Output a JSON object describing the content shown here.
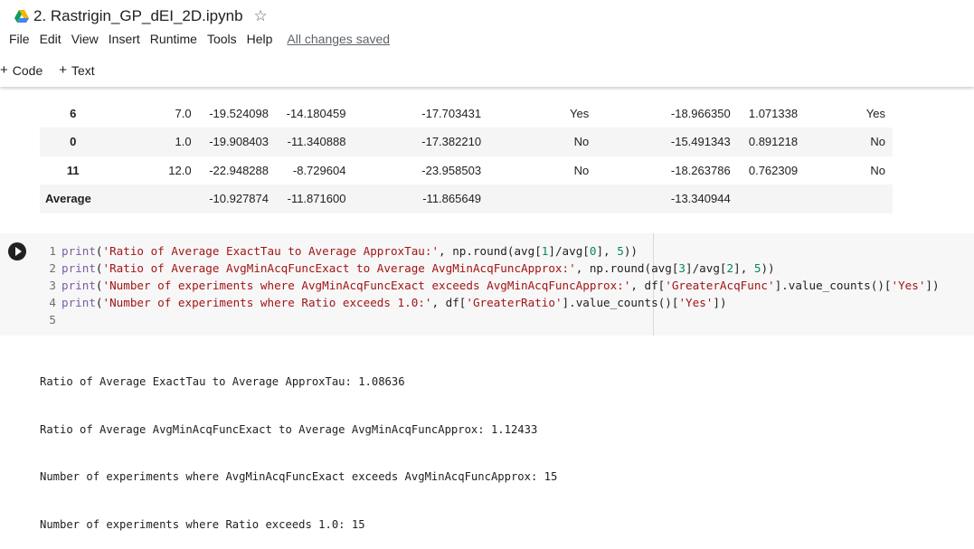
{
  "notebook": {
    "title": "2. Rastrigin_GP_dEI_2D.ipynb",
    "menu": [
      "File",
      "Edit",
      "View",
      "Insert",
      "Runtime",
      "Tools",
      "Help"
    ],
    "saved_status": "All changes saved"
  },
  "toolbar": {
    "code_label": "Code",
    "text_label": "Text"
  },
  "colors": {
    "drive_yellow": "#f4b400",
    "drive_green": "#0f9d58",
    "drive_blue": "#4285f4"
  },
  "table": {
    "rows": [
      {
        "index": "6",
        "c1": "7.0",
        "c2": "-19.524098",
        "c3": "-14.180459",
        "c4": "-17.703431",
        "c5": "Yes",
        "c6": "-18.966350",
        "c7": "1.071338",
        "c8": "Yes"
      },
      {
        "index": "0",
        "c1": "1.0",
        "c2": "-19.908403",
        "c3": "-11.340888",
        "c4": "-17.382210",
        "c5": "No",
        "c6": "-15.491343",
        "c7": "0.891218",
        "c8": "No"
      },
      {
        "index": "11",
        "c1": "12.0",
        "c2": "-22.948288",
        "c3": "-8.729604",
        "c4": "-23.958503",
        "c5": "No",
        "c6": "-18.263786",
        "c7": "0.762309",
        "c8": "No"
      },
      {
        "index": "Average",
        "c1": "",
        "c2": "-10.927874",
        "c3": "-11.871600",
        "c4": "-11.865649",
        "c5": "",
        "c6": "-13.340944",
        "c7": "",
        "c8": ""
      }
    ]
  },
  "code": {
    "lines": [
      {
        "num": "1",
        "parts": [
          [
            "kw",
            "print"
          ],
          [
            "txt",
            "("
          ],
          [
            "str",
            "'Ratio of Average ExactTau to Average ApproxTau:'"
          ],
          [
            "txt",
            ", np.round(avg["
          ],
          [
            "num",
            "1"
          ],
          [
            "txt",
            "]/avg["
          ],
          [
            "num",
            "0"
          ],
          [
            "txt",
            "], "
          ],
          [
            "num",
            "5"
          ],
          [
            "txt",
            "))"
          ]
        ]
      },
      {
        "num": "2",
        "parts": [
          [
            "kw",
            "print"
          ],
          [
            "txt",
            "("
          ],
          [
            "str",
            "'Ratio of Average AvgMinAcqFuncExact to Average AvgMinAcqFuncApprox:'"
          ],
          [
            "txt",
            ", np.round(avg["
          ],
          [
            "num",
            "3"
          ],
          [
            "txt",
            "]/avg["
          ],
          [
            "num",
            "2"
          ],
          [
            "txt",
            "], "
          ],
          [
            "num",
            "5"
          ],
          [
            "txt",
            "))"
          ]
        ]
      },
      {
        "num": "3",
        "parts": [
          [
            "kw",
            "print"
          ],
          [
            "txt",
            "("
          ],
          [
            "str",
            "'Number of experiments where AvgMinAcqFuncExact exceeds AvgMinAcqFuncApprox:'"
          ],
          [
            "txt",
            ", df["
          ],
          [
            "str",
            "'GreaterAcqFunc'"
          ],
          [
            "txt",
            "].value_counts()["
          ],
          [
            "str",
            "'Yes'"
          ],
          [
            "txt",
            "])"
          ]
        ]
      },
      {
        "num": "4",
        "parts": [
          [
            "kw",
            "print"
          ],
          [
            "txt",
            "("
          ],
          [
            "str",
            "'Number of experiments where Ratio exceeds 1.0:'"
          ],
          [
            "txt",
            ", df["
          ],
          [
            "str",
            "'GreaterRatio'"
          ],
          [
            "txt",
            "].value_counts()["
          ],
          [
            "str",
            "'Yes'"
          ],
          [
            "txt",
            "])"
          ]
        ]
      },
      {
        "num": "5",
        "parts": []
      }
    ]
  },
  "output": {
    "lines": [
      "Ratio of Average ExactTau to Average ApproxTau: 1.08636",
      "Ratio of Average AvgMinAcqFuncExact to Average AvgMinAcqFuncApprox: 1.12433",
      "Number of experiments where AvgMinAcqFuncExact exceeds AvgMinAcqFuncApprox: 15",
      "Number of experiments where Ratio exceeds 1.0: 15"
    ]
  }
}
